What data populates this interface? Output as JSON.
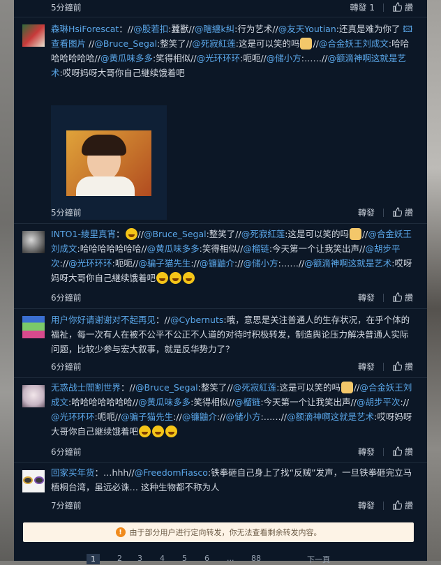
{
  "top": {
    "time": "5分鐘前",
    "repost": "轉發 1",
    "like": "讚"
  },
  "comments": [
    {
      "user": "森琳HsiForescat",
      "segments": [
        {
          "t": "：//"
        },
        {
          "m": "@股若扣"
        },
        {
          "t": ":蠶獸//"
        },
        {
          "m": "@瞎纏k糾"
        },
        {
          "t": ":行为艺术//"
        },
        {
          "m": "@友天Youtian"
        },
        {
          "t": ":还真是难为你了 "
        },
        {
          "m": "🖾 查看图片"
        },
        {
          "t": " //"
        },
        {
          "m": "@Bruce_Segal"
        },
        {
          "t": ":整笑了//"
        },
        {
          "m": "@死寂紅莲"
        },
        {
          "t": ":这是可以笑的吗"
        },
        {
          "e": "cat"
        },
        {
          "t": "//"
        },
        {
          "m": "@合金妖王刘成文"
        },
        {
          "t": ":哈哈哈哈哈哈哈//"
        },
        {
          "m": "@黄瓜味多多"
        },
        {
          "t": ":笑得相似//"
        },
        {
          "m": "@光环环环"
        },
        {
          "t": ":呃呃//"
        },
        {
          "m": "@储小方"
        },
        {
          "t": ":……//"
        },
        {
          "m": "@额滴神啊这就是艺术"
        },
        {
          "t": ":哎呀妈呀大哥你自己継续饿着吧"
        }
      ],
      "time": "5分鐘前",
      "repost": "轉發",
      "like": "讚"
    },
    {
      "user": "INTO1-綾里真宵",
      "segments": [
        {
          "t": "："
        },
        {
          "e": "laugh"
        },
        {
          "t": "//"
        },
        {
          "m": "@Bruce_Segal"
        },
        {
          "t": ":整笑了//"
        },
        {
          "m": "@死寂紅莲"
        },
        {
          "t": ":这是可以笑的吗"
        },
        {
          "e": "cat"
        },
        {
          "t": "//"
        },
        {
          "m": "@合金妖王刘成文"
        },
        {
          "t": ":哈哈哈哈哈哈哈//"
        },
        {
          "m": "@黄瓜味多多"
        },
        {
          "t": ":笑得相似//"
        },
        {
          "m": "@榴链"
        },
        {
          "t": ":今天第一个让我笑出声//"
        },
        {
          "m": "@胡步平次"
        },
        {
          "t": "://"
        },
        {
          "m": "@光环环环"
        },
        {
          "t": ":呃呃//"
        },
        {
          "m": "@骗子猫先生"
        },
        {
          "t": "://"
        },
        {
          "m": "@镰鼬介"
        },
        {
          "t": "://"
        },
        {
          "m": "@储小方"
        },
        {
          "t": ":……//"
        },
        {
          "m": "@额滴神啊这就是艺术"
        },
        {
          "t": ":哎呀妈呀大哥你自己継续饿着吧"
        },
        {
          "e": "laugh"
        },
        {
          "e": "laugh"
        },
        {
          "e": "laugh"
        }
      ],
      "time": "6分鐘前",
      "repost": "轉發",
      "like": "讚"
    },
    {
      "user": "用户你好请谢谢对不起再见",
      "segments": [
        {
          "t": "：//"
        },
        {
          "m": "@Cybernuts"
        },
        {
          "t": ":哦，意思是关注普通人的生存状况，在乎个体的福祉，每一次有人在被不公平不公正不人道的对待时积极转发，制造舆论压力解决普通人实际问题，比较少参与宏大叙事，就是反华势力了？"
        }
      ],
      "time": "6分鐘前",
      "repost": "轉發",
      "like": "讚"
    },
    {
      "user": "无惑战士閻割世界",
      "segments": [
        {
          "t": "：//"
        },
        {
          "m": "@Bruce_Segal"
        },
        {
          "t": ":整笑了//"
        },
        {
          "m": "@死寂紅莲"
        },
        {
          "t": ":这是可以笑的吗"
        },
        {
          "e": "cat"
        },
        {
          "t": "//"
        },
        {
          "m": "@合金妖王刘成文"
        },
        {
          "t": ":哈哈哈哈哈哈哈//"
        },
        {
          "m": "@黄瓜味多多"
        },
        {
          "t": ":笑得相似//"
        },
        {
          "m": "@榴链"
        },
        {
          "t": ":今天第一个让我笑出声//"
        },
        {
          "m": "@胡步平次"
        },
        {
          "t": "://"
        },
        {
          "m": "@光环环环"
        },
        {
          "t": ":呃呃//"
        },
        {
          "m": "@骗子猫先生"
        },
        {
          "t": "://"
        },
        {
          "m": "@镰鼬介"
        },
        {
          "t": "://"
        },
        {
          "m": "@储小方"
        },
        {
          "t": ":……//"
        },
        {
          "m": "@额滴神啊这就是艺术"
        },
        {
          "t": ":哎呀妈呀大哥你自己継续饿着吧"
        },
        {
          "e": "laugh"
        },
        {
          "e": "laugh"
        },
        {
          "e": "laugh"
        }
      ],
      "time": "6分鐘前",
      "repost": "轉發",
      "like": "讚"
    },
    {
      "user": "回家买年货",
      "segments": [
        {
          "t": "：…hhh//"
        },
        {
          "m": "@FreedomFiasco"
        },
        {
          "t": ":铁拳砸自己身上了找“反贼”发声，一旦铁拳砸完立马梧桐台湾，虽远必诛… 这种生物都不称为人"
        }
      ],
      "time": "7分鐘前",
      "repost": "轉發",
      "like": "讚"
    }
  ],
  "notice": {
    "icon": "!",
    "text": "由于部分用户进行定向转发，你无法查看剩余转发内容。"
  },
  "pager": {
    "pages": [
      "1",
      "2",
      "3",
      "4",
      "5",
      "6",
      "...",
      "88"
    ],
    "next": "下一頁"
  }
}
